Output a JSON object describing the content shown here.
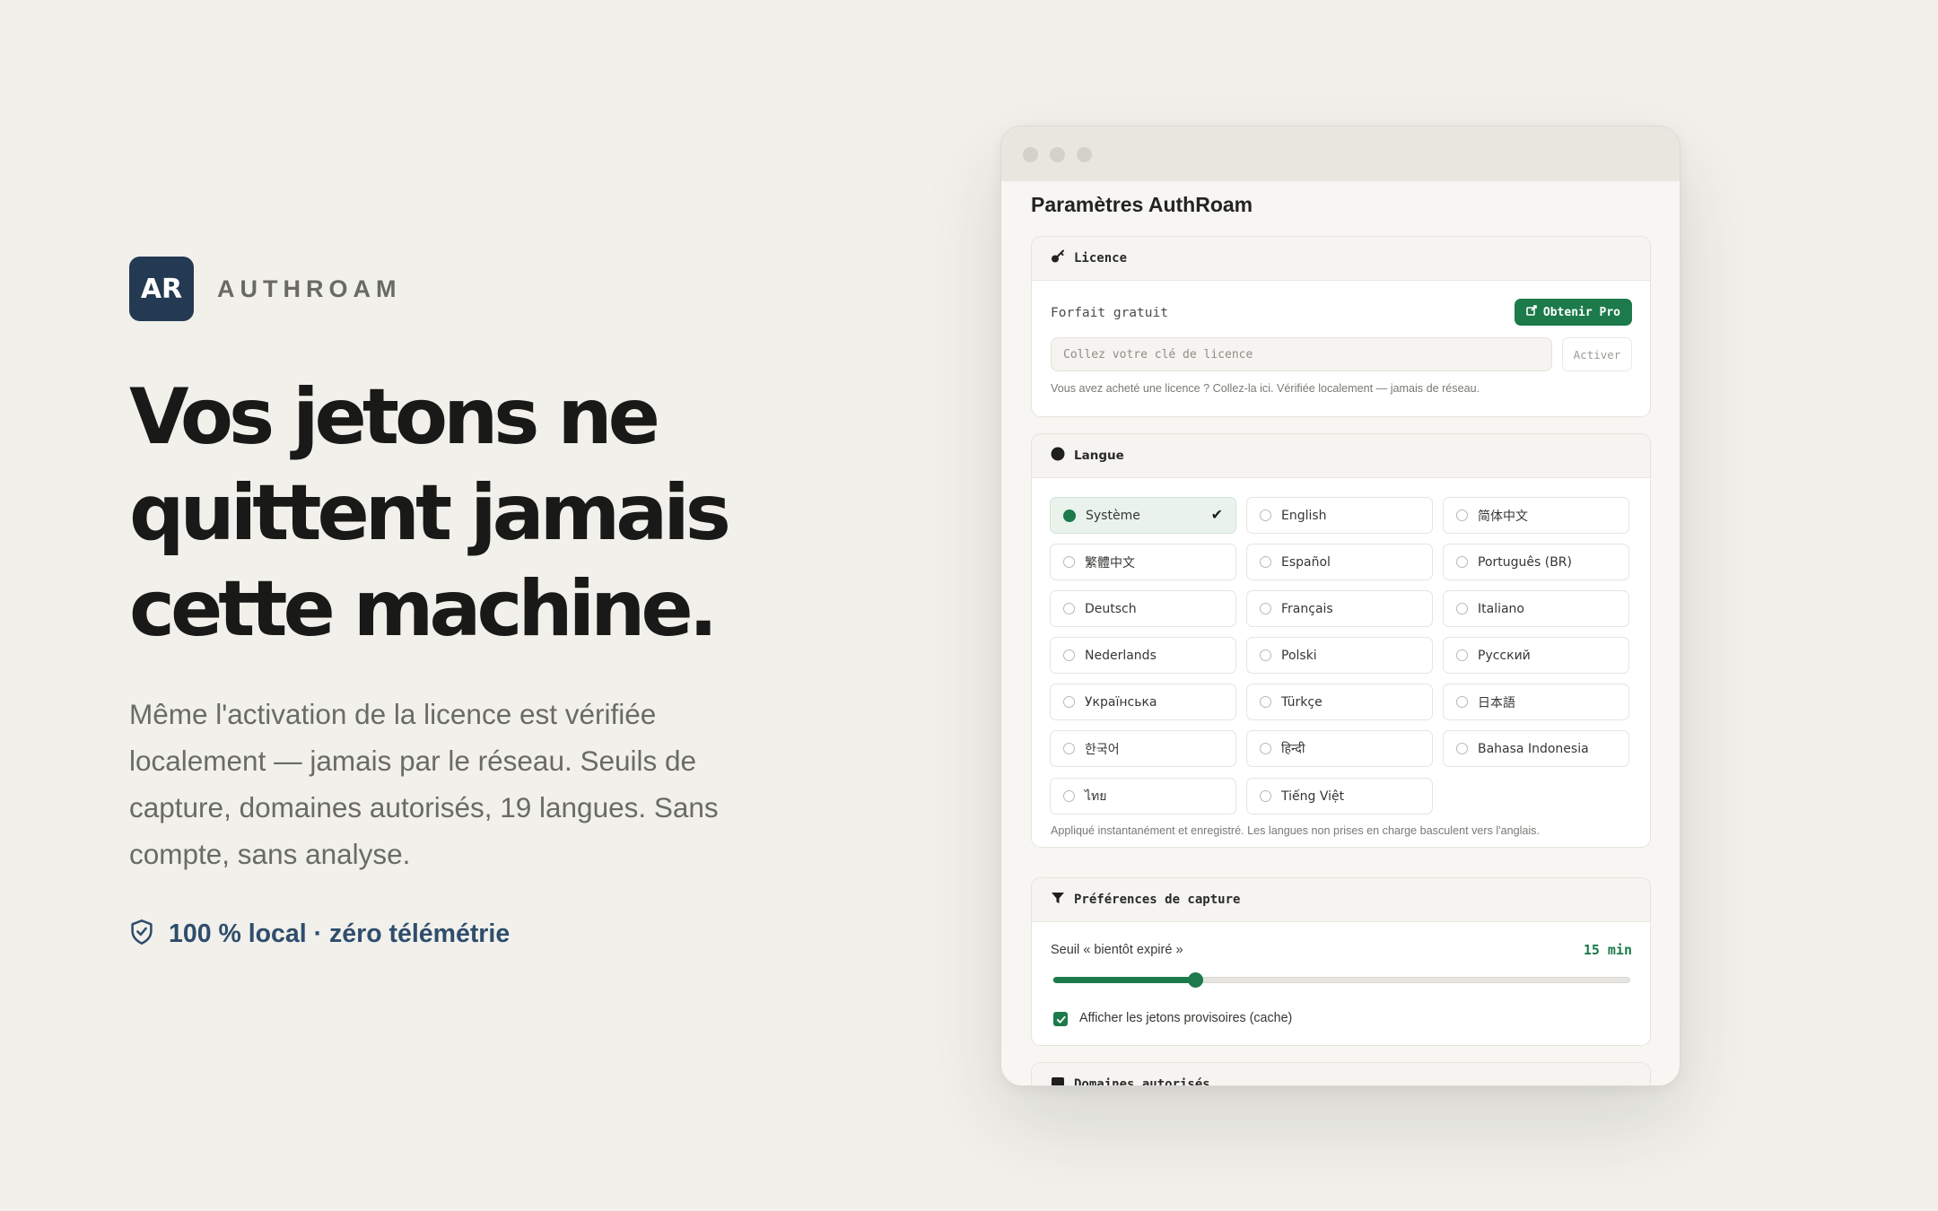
{
  "brand": {
    "logo_text": "AR",
    "name": "AUTHROAM"
  },
  "hero": {
    "headline_lines": [
      "Vos jetons ne",
      "quittent jamais",
      "cette machine."
    ],
    "subtitle": "Même l'activation de la licence est vérifiée localement — jamais par le réseau. Seuils de capture, domaines autorisés, 19 langues. Sans compte, sans analyse.",
    "trust_label": "100 % local · zéro télémétrie",
    "trust_icon": "shield-check-icon"
  },
  "window": {
    "title": "Paramètres AuthRoam",
    "licence": {
      "heading": "Licence",
      "icon": "key-icon",
      "plan": "Forfait gratuit",
      "get_pro_label": "Obtenir Pro",
      "get_pro_icon": "external-link-icon",
      "key_value": "",
      "key_placeholder": "Collez votre clé de licence",
      "activate_label": "Activer",
      "hint": "Vous avez acheté une licence ? Collez-la ici. Vérifiée localement — jamais de réseau."
    },
    "language": {
      "heading": "Langue",
      "icon": "globe-icon",
      "selected": "Système",
      "options": [
        "Système",
        "English",
        "简体中文",
        "繁體中文",
        "Español",
        "Português (BR)",
        "Deutsch",
        "Français",
        "Italiano",
        "Nederlands",
        "Polski",
        "Русский",
        "Українська",
        "Türkçe",
        "日本語",
        "한국어",
        "हिन्दी",
        "Bahasa Indonesia",
        "ไทย",
        "Tiếng Việt"
      ],
      "hint": "Appliqué instantanément et enregistré. Les langues non prises en charge basculent vers l'anglais."
    },
    "capture": {
      "heading": "Préférences de capture",
      "icon": "filter-icon",
      "threshold_label": "Seuil « bientôt expiré »",
      "threshold_value": "15 min",
      "slider_fraction": 0.245,
      "checkbox_label": "Afficher les jetons provisoires (cache)",
      "checkbox_checked": true
    },
    "domains": {
      "heading": "Domaines autorisés"
    }
  },
  "colors": {
    "accent": "#1c7a4b",
    "logo_bg": "#243a52",
    "trust_text": "#2f4d6c",
    "page_bg": "#f1f0eb"
  }
}
